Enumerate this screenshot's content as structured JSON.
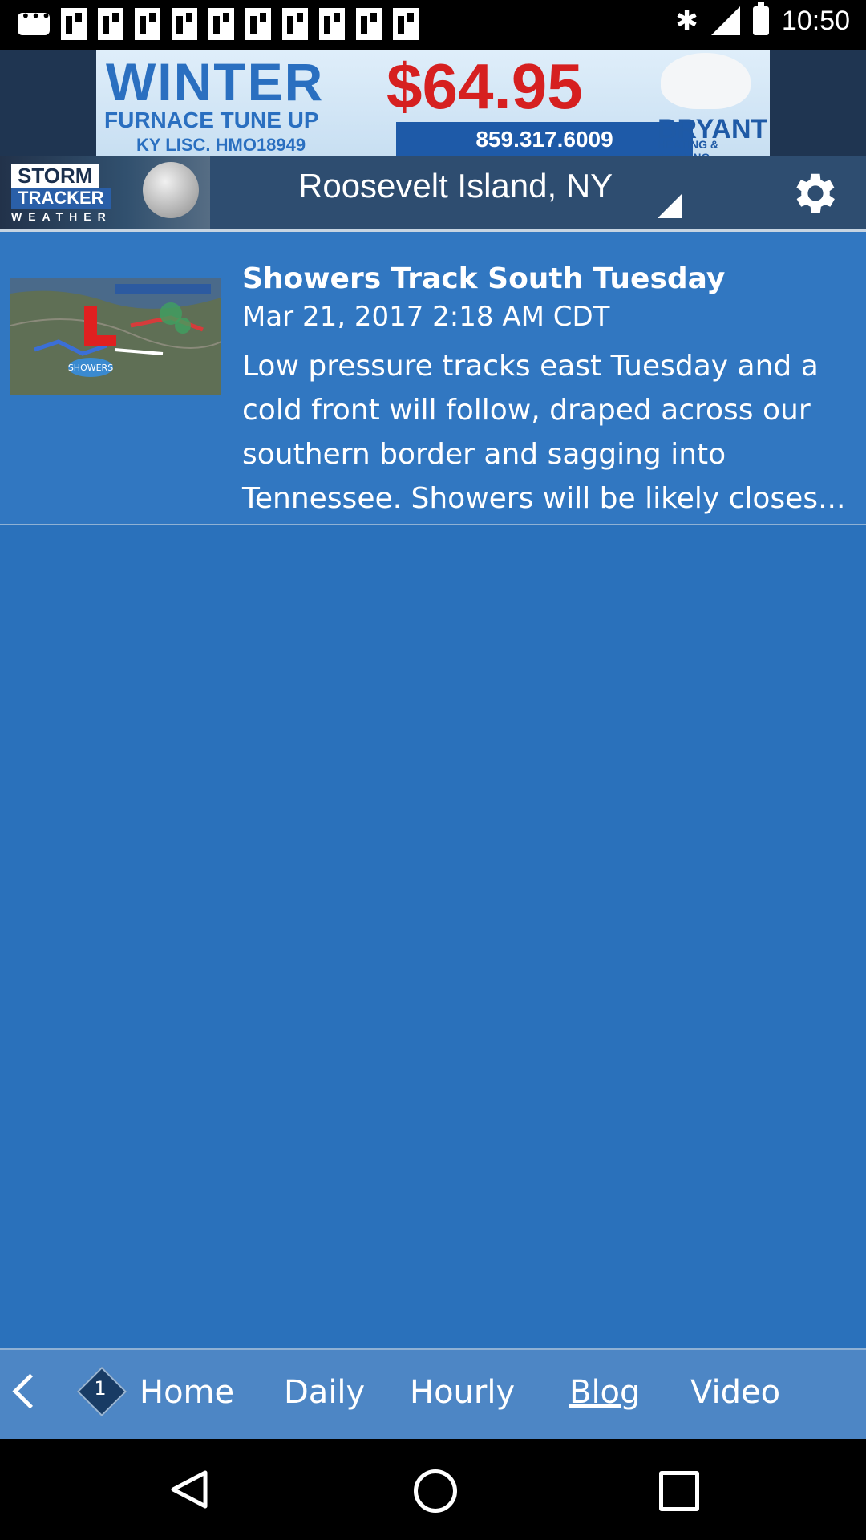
{
  "status_bar": {
    "time": "10:50",
    "icons": [
      "message-icon",
      "flipboard-icon",
      "flipboard-icon",
      "flipboard-icon",
      "flipboard-icon",
      "flipboard-icon",
      "flipboard-icon",
      "flipboard-icon",
      "flipboard-icon",
      "flipboard-icon",
      "flipboard-icon",
      "bluetooth-icon",
      "signal-icon",
      "battery-icon"
    ]
  },
  "ad": {
    "headline": "WINTER",
    "subline": "FURNACE TUNE UP",
    "license": "KY LISC. HMO18949",
    "price": "$64.95",
    "phone": "859.317.6009",
    "brand": "BRYANT",
    "brand_sub": "HEATING & COOLING"
  },
  "header": {
    "logo": {
      "storm": "STORM",
      "tracker": "TRACKER",
      "weather": "WEATHER"
    },
    "location": "Roosevelt Island, NY",
    "settings_icon": "gear-icon"
  },
  "posts": [
    {
      "title": "Showers Track South Tuesday",
      "date": "Mar 21, 2017 2:18 AM CDT",
      "excerpt": "Low pressure tracks east Tuesday and a cold front will follow, draped across our southern border and sagging into Tennessee. Showers will be likely closes...",
      "thumbnail_label": "SHOWERS"
    }
  ],
  "bottom_nav": {
    "badge": "1",
    "items": [
      {
        "label": "Home"
      },
      {
        "label": "Daily"
      },
      {
        "label": "Hourly"
      },
      {
        "label": "Blog"
      },
      {
        "label": "Video"
      }
    ],
    "active": "Blog"
  },
  "colors": {
    "main_bg": "#2a71bb",
    "header_bg": "#2e4d70",
    "nav_bg": "#4d86c5"
  }
}
